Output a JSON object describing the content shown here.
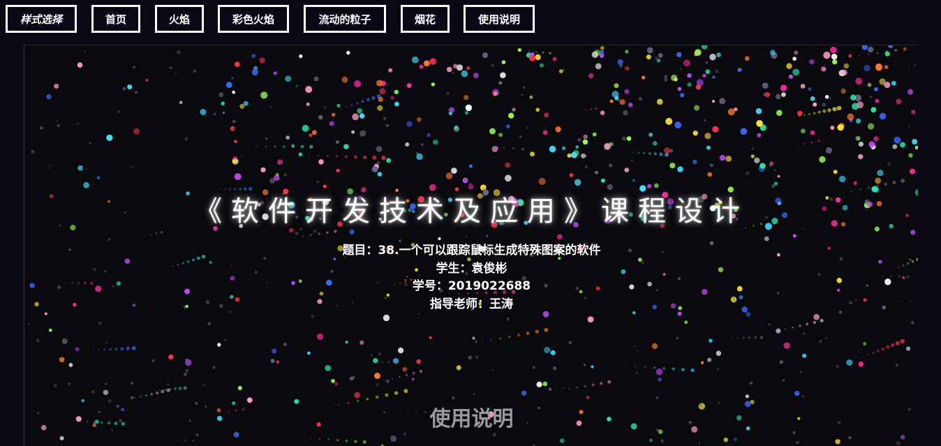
{
  "nav": {
    "items": [
      {
        "label": "样式选择",
        "italic": true
      },
      {
        "label": "首页"
      },
      {
        "label": "火焰"
      },
      {
        "label": "彩色火焰"
      },
      {
        "label": "流动的粒子"
      },
      {
        "label": "烟花"
      },
      {
        "label": "使用说明"
      }
    ]
  },
  "hero": {
    "title": "《软件开发技术及应用》课程设计",
    "topic": "题目：38.一个可以跟踪鼠标生成特殊图案的软件",
    "student": "学生：袁俊彬",
    "student_id": "学号：2019022688",
    "advisor": "指导老师：王涛"
  },
  "section": {
    "usage_heading": "使用说明"
  },
  "theme": {
    "background": "#0b0816",
    "canvas_background": "#0a0a0e",
    "text": "#ffffff",
    "muted_heading": "#9a9aa0",
    "particle_colors": [
      "#ff2fa0",
      "#2ee6a8",
      "#ffffff",
      "#c94cff",
      "#3b6cff",
      "#ff7a2e",
      "#ffe23a",
      "#ff3355",
      "#44ddff",
      "#9cff5a",
      "#ff9ec9",
      "#6a6a8a"
    ]
  }
}
